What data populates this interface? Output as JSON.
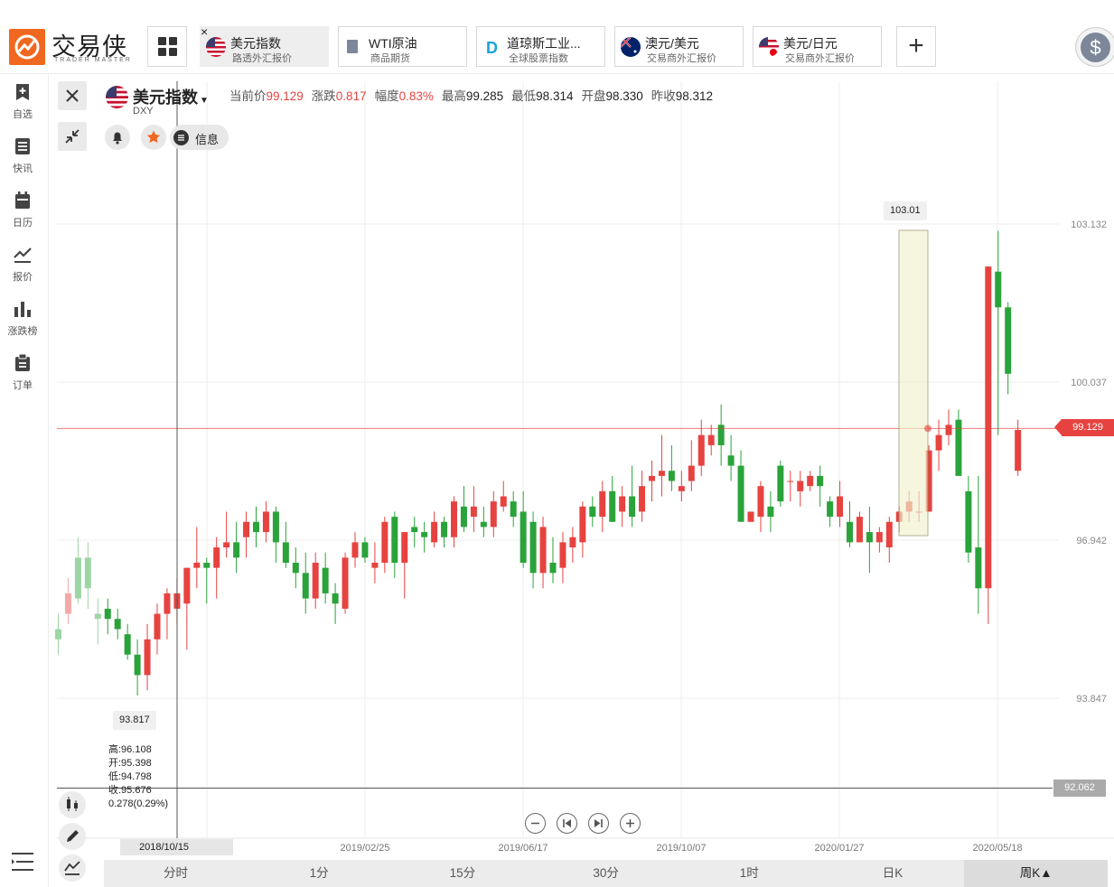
{
  "app": {
    "logo_name": "交易侠",
    "logo_sub": "TRADER MASTER"
  },
  "tabs": [
    {
      "title": "美元指数",
      "subtitle": "路透外汇报价",
      "active": true,
      "flag": "us"
    },
    {
      "title": "WTI原油",
      "subtitle": "商品期货",
      "active": false,
      "flag": "oil"
    },
    {
      "title": "道琼斯工业...",
      "subtitle": "全球股票指数",
      "active": false,
      "flag": "dj"
    },
    {
      "title": "澳元/美元",
      "subtitle": "交易商外汇报价",
      "active": false,
      "flag": "au"
    },
    {
      "title": "美元/日元",
      "subtitle": "交易商外汇报价",
      "active": false,
      "flag": "jp"
    }
  ],
  "add_tab_label": "+",
  "close_tab_label": "×",
  "dollar_label": "$",
  "sidebar": [
    {
      "label": "自选",
      "icon": "add-bookmark-icon"
    },
    {
      "label": "快讯",
      "icon": "news-list-icon"
    },
    {
      "label": "日历",
      "icon": "calendar-icon"
    },
    {
      "label": "报价",
      "icon": "line-chart-icon"
    },
    {
      "label": "涨跌榜",
      "icon": "bar-chart-icon"
    },
    {
      "label": "订单",
      "icon": "clipboard-icon"
    }
  ],
  "instrument": {
    "name": "美元指数",
    "code": "DXY",
    "stats": [
      {
        "label": "当前价",
        "value": "99.129",
        "up": true
      },
      {
        "label": "涨跌",
        "value": "0.817",
        "up": true
      },
      {
        "label": "幅度",
        "value": "0.83%",
        "up": true
      },
      {
        "label": "最高",
        "value": "99.285",
        "up": false
      },
      {
        "label": "最低",
        "value": "98.314",
        "up": false
      },
      {
        "label": "开盘",
        "value": "98.330",
        "up": false
      },
      {
        "label": "昨收",
        "value": "98.312",
        "up": false
      }
    ],
    "info_label": "信息"
  },
  "ohlc_readout": [
    "高:96.108",
    "开:95.398",
    "低:94.798",
    "收:95.676",
    "0.278(0.29%)"
  ],
  "crosshair": {
    "date": "2018/10/15",
    "price": "92.062"
  },
  "markers": {
    "high": "103.01",
    "low": "93.817",
    "current": "99.129"
  },
  "colors": {
    "up": "#e64340",
    "down": "#2aa33a",
    "accent": "#f0671f"
  },
  "chart_data": {
    "type": "candlestick",
    "y_ticks": [
      "103.132",
      "100.037",
      "96.942",
      "93.847"
    ],
    "x_ticks": [
      "2018/10/15",
      "2019/02/25",
      "2019/06/17",
      "2019/10/07",
      "2020/01/27",
      "2020/05/18"
    ],
    "candles": [
      [
        95.2,
        95.5,
        94.7,
        95.0
      ],
      [
        95.5,
        96.2,
        95.3,
        95.9
      ],
      [
        96.6,
        97.0,
        95.7,
        95.8
      ],
      [
        96.6,
        96.9,
        95.6,
        96.0
      ],
      [
        95.5,
        95.8,
        94.9,
        95.4
      ],
      [
        95.6,
        95.8,
        95.1,
        95.4
      ],
      [
        95.4,
        95.6,
        95.0,
        95.2
      ],
      [
        95.1,
        95.3,
        94.6,
        94.7
      ],
      [
        94.7,
        95.0,
        93.9,
        94.3
      ],
      [
        94.3,
        95.3,
        94.0,
        95.0
      ],
      [
        95.0,
        95.7,
        94.7,
        95.5
      ],
      [
        95.5,
        96.0,
        95.0,
        95.9
      ],
      [
        95.6,
        96.2,
        95.3,
        95.9
      ],
      [
        95.7,
        96.4,
        94.8,
        96.4
      ],
      [
        96.4,
        97.2,
        96.0,
        96.5
      ],
      [
        96.5,
        96.6,
        95.7,
        96.4
      ],
      [
        96.4,
        97.0,
        95.8,
        96.8
      ],
      [
        96.8,
        97.5,
        96.6,
        96.9
      ],
      [
        96.9,
        97.3,
        96.3,
        96.6
      ],
      [
        97.0,
        97.5,
        96.6,
        97.3
      ],
      [
        97.3,
        97.6,
        96.8,
        97.1
      ],
      [
        97.1,
        97.7,
        96.9,
        97.5
      ],
      [
        97.5,
        97.6,
        96.5,
        96.9
      ],
      [
        96.9,
        97.3,
        96.4,
        96.5
      ],
      [
        96.5,
        96.8,
        96.0,
        96.3
      ],
      [
        96.3,
        96.7,
        95.5,
        95.8
      ],
      [
        95.8,
        96.7,
        95.6,
        96.5
      ],
      [
        96.4,
        96.7,
        95.7,
        95.9
      ],
      [
        95.9,
        96.1,
        95.3,
        95.7
      ],
      [
        95.6,
        96.7,
        95.5,
        96.6
      ],
      [
        96.6,
        97.1,
        96.4,
        96.9
      ],
      [
        96.9,
        97.0,
        96.5,
        96.6
      ],
      [
        96.4,
        96.9,
        96.1,
        96.5
      ],
      [
        96.5,
        97.4,
        96.3,
        97.3
      ],
      [
        97.4,
        97.5,
        96.2,
        96.5
      ],
      [
        96.5,
        97.1,
        95.8,
        97.1
      ],
      [
        97.2,
        97.4,
        96.8,
        97.1
      ],
      [
        97.1,
        97.3,
        96.7,
        97.0
      ],
      [
        96.9,
        97.5,
        96.8,
        97.3
      ],
      [
        97.3,
        97.4,
        96.8,
        97.0
      ],
      [
        97.0,
        97.8,
        96.8,
        97.7
      ],
      [
        97.6,
        98.0,
        97.1,
        97.2
      ],
      [
        97.4,
        98.0,
        97.1,
        97.6
      ],
      [
        97.3,
        97.6,
        97.0,
        97.2
      ],
      [
        97.2,
        97.9,
        97.0,
        97.7
      ],
      [
        97.6,
        98.1,
        97.5,
        97.8
      ],
      [
        97.7,
        97.9,
        97.2,
        97.4
      ],
      [
        97.5,
        97.9,
        96.4,
        96.5
      ],
      [
        97.3,
        97.5,
        96.0,
        96.3
      ],
      [
        96.3,
        97.4,
        96.0,
        97.2
      ],
      [
        96.5,
        97.0,
        96.1,
        96.3
      ],
      [
        96.4,
        97.1,
        96.1,
        96.9
      ],
      [
        96.8,
        97.2,
        96.5,
        97.0
      ],
      [
        96.9,
        97.7,
        96.6,
        97.6
      ],
      [
        97.6,
        97.8,
        97.2,
        97.4
      ],
      [
        97.4,
        98.1,
        97.1,
        97.9
      ],
      [
        97.9,
        98.2,
        97.3,
        97.3
      ],
      [
        97.5,
        98.0,
        97.2,
        97.8
      ],
      [
        97.8,
        98.4,
        97.2,
        97.4
      ],
      [
        97.5,
        98.3,
        97.3,
        98.0
      ],
      [
        98.1,
        98.5,
        97.7,
        98.2
      ],
      [
        98.2,
        99.0,
        97.8,
        98.3
      ],
      [
        98.3,
        98.8,
        97.9,
        98.1
      ],
      [
        97.9,
        98.3,
        97.7,
        98.0
      ],
      [
        98.1,
        98.9,
        97.9,
        98.4
      ],
      [
        98.4,
        99.3,
        98.2,
        99.0
      ],
      [
        98.8,
        99.2,
        98.6,
        99.0
      ],
      [
        99.2,
        99.6,
        98.4,
        98.8
      ],
      [
        98.6,
        99.0,
        98.1,
        98.4
      ],
      [
        98.4,
        98.7,
        97.3,
        97.3
      ],
      [
        97.3,
        97.5,
        97.3,
        97.5
      ],
      [
        97.4,
        98.1,
        97.1,
        98.0
      ],
      [
        97.6,
        97.9,
        97.1,
        97.4
      ],
      [
        98.4,
        98.5,
        97.6,
        97.7
      ],
      [
        98.1,
        98.3,
        97.7,
        98.1
      ],
      [
        97.9,
        98.3,
        97.6,
        98.1
      ],
      [
        98.0,
        98.3,
        97.9,
        98.2
      ],
      [
        98.2,
        98.4,
        97.6,
        98.0
      ],
      [
        97.7,
        97.8,
        97.2,
        97.4
      ],
      [
        97.4,
        98.1,
        97.2,
        97.8
      ],
      [
        97.3,
        97.7,
        96.8,
        96.9
      ],
      [
        96.9,
        97.5,
        96.9,
        97.4
      ],
      [
        97.1,
        97.6,
        96.3,
        96.9
      ],
      [
        96.9,
        97.2,
        96.7,
        97.1
      ],
      [
        96.8,
        97.4,
        96.5,
        97.3
      ],
      [
        97.3,
        97.6,
        97.1,
        97.5
      ],
      [
        97.5,
        97.9,
        97.3,
        97.7
      ],
      [
        97.5,
        97.9,
        97.3,
        97.5
      ],
      [
        97.5,
        98.8,
        97.5,
        98.7
      ],
      [
        98.7,
        99.3,
        98.3,
        99.0
      ],
      [
        99.0,
        99.5,
        98.8,
        99.2
      ],
      [
        99.3,
        99.5,
        98.2,
        98.2
      ],
      [
        97.9,
        98.2,
        96.5,
        96.7
      ],
      [
        96.8,
        98.2,
        95.5,
        96.0
      ],
      [
        96.0,
        102.3,
        95.3,
        102.3
      ],
      [
        102.2,
        103.0,
        99.0,
        101.5
      ],
      [
        101.5,
        101.6,
        99.8,
        100.2
      ],
      [
        98.3,
        99.3,
        98.2,
        99.1
      ]
    ]
  }
}
